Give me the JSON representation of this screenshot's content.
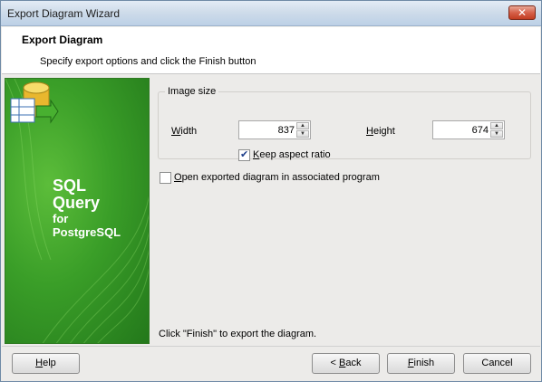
{
  "window": {
    "title": "Export Diagram Wizard",
    "close_glyph": "✕"
  },
  "header": {
    "title": "Export Diagram",
    "subtitle": "Specify export options and click the Finish button"
  },
  "banner": {
    "line1": "SQL",
    "line2": "Query",
    "line3": "for",
    "line4": "PostgreSQL",
    "icon": "sql-query-logo-icon",
    "colors": {
      "green": "#3a9e28",
      "dark_green": "#23781b"
    }
  },
  "image_size": {
    "group_label": "Image size",
    "width_label_accel": "W",
    "width_label_rest": "idth",
    "width_value": "837",
    "height_label_accel": "H",
    "height_label_rest": "eight",
    "height_value": "674",
    "keep_aspect_accel": "K",
    "keep_aspect_rest": "eep aspect ratio",
    "keep_aspect_checked": true
  },
  "open_in_program": {
    "accel": "O",
    "rest": "pen exported diagram in associated program",
    "checked": false
  },
  "hint": "Click \"Finish\" to export the diagram.",
  "buttons": {
    "help_accel": "H",
    "help_rest": "elp",
    "back_pre": "< ",
    "back_accel": "B",
    "back_rest": "ack",
    "finish_accel": "F",
    "finish_rest": "inish",
    "cancel": "Cancel"
  }
}
